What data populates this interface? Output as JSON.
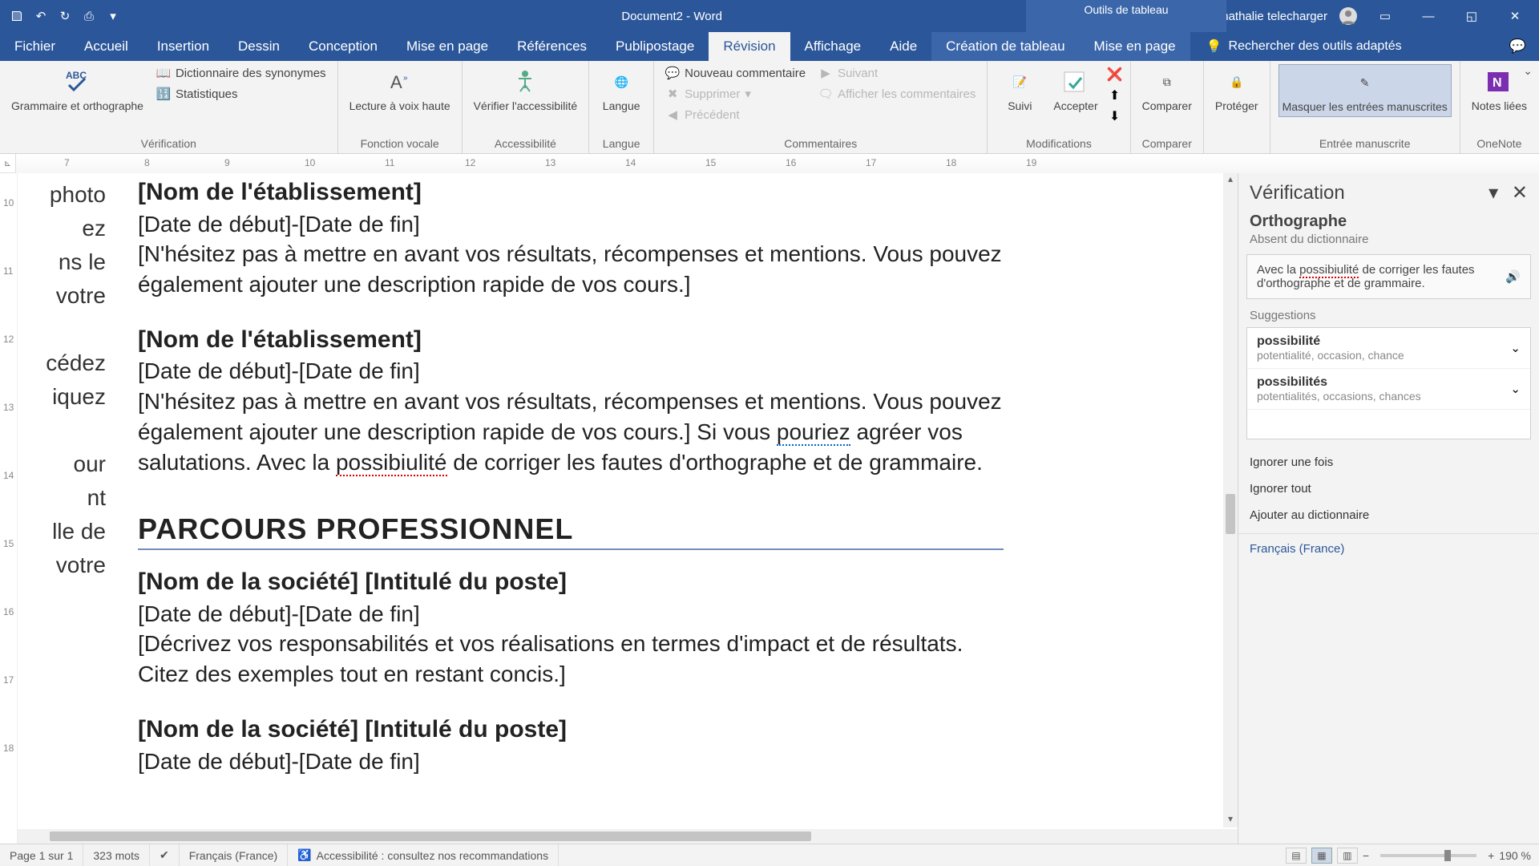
{
  "title": "Document2 - Word",
  "tableTools": "Outils de tableau",
  "userName": "nathalie telecharger",
  "tabs": {
    "file": "Fichier",
    "home": "Accueil",
    "insert": "Insertion",
    "draw": "Dessin",
    "design": "Conception",
    "layout": "Mise en page",
    "references": "Références",
    "mailings": "Publipostage",
    "review": "Révision",
    "view": "Affichage",
    "help": "Aide",
    "tableDesign": "Création de tableau",
    "tableLayout": "Mise en page",
    "tellMe": "Rechercher des outils adaptés"
  },
  "ribbon": {
    "proofing": {
      "spelling": "Grammaire et orthographe",
      "thesaurus": "Dictionnaire des synonymes",
      "stats": "Statistiques",
      "label": "Vérification"
    },
    "speech": {
      "readAloud": "Lecture à voix haute",
      "label": "Fonction vocale"
    },
    "a11y": {
      "check": "Vérifier l'accessibilité",
      "label": "Accessibilité"
    },
    "language": {
      "btn": "Langue",
      "label": "Langue"
    },
    "comments": {
      "new": "Nouveau commentaire",
      "delete": "Supprimer",
      "prev": "Précédent",
      "next": "Suivant",
      "show": "Afficher les commentaires",
      "label": "Commentaires"
    },
    "tracking": {
      "track": "Suivi",
      "label": "Modifications"
    },
    "accept": "Accepter",
    "compare": {
      "btn": "Comparer",
      "label": "Comparer"
    },
    "protect": "Protéger",
    "ink": {
      "hide": "Masquer les entrées manuscrites",
      "label": "Entrée manuscrite"
    },
    "onenote": {
      "linked": "Notes liées",
      "label": "OneNote"
    }
  },
  "hruler": [
    "7",
    "8",
    "9",
    "10",
    "11",
    "12",
    "13",
    "14",
    "15",
    "16",
    "17",
    "18",
    "19"
  ],
  "vruler": [
    "10",
    "11",
    "12",
    "13",
    "14",
    "15",
    "16",
    "17",
    "18"
  ],
  "leftStrip": [
    "photo",
    "ez",
    "ns le",
    "votre",
    "",
    "cédez",
    "iquez",
    "",
    "our",
    "nt",
    "lle de",
    "votre"
  ],
  "doc": {
    "s1": {
      "title": "[Nom de l'établissement]",
      "dates": "[Date de début]-[Date de fin]",
      "body": "[N'hésitez pas à mettre en avant vos résultats, récompenses et mentions. Vous pouvez également ajouter une description rapide de vos cours.]"
    },
    "s2": {
      "title": "[Nom de l'établissement]",
      "dates": "[Date de début]-[Date de fin]",
      "body_a": "[N'hésitez pas à mettre en avant vos résultats, récompenses et mentions. Vous pouvez également ajouter une description rapide de vos cours.] Si vous ",
      "err1": "pouriez",
      "body_b": " agréer vos salutations. Avec la ",
      "err2": "possibiulité",
      "body_c": " de corriger les fautes d'orthographe et de grammaire."
    },
    "h2": "PARCOURS PROFESSIONNEL",
    "s3": {
      "title": "[Nom de la société] [Intitulé du poste]",
      "dates": "[Date de début]-[Date de fin]",
      "body": "[Décrivez vos responsabilités et vos réalisations en termes d'impact et de résultats. Citez des exemples tout en restant concis.]"
    },
    "s4": {
      "title": "[Nom de la société] [Intitulé du poste]",
      "dates": "[Date de début]-[Date de fin]"
    }
  },
  "pane": {
    "title": "Vérification",
    "cat": "Orthographe",
    "sub": "Absent du dictionnaire",
    "context_a": "Avec la ",
    "context_err": "possibiulité",
    "context_b": " de corriger les fautes d'orthographe et de grammaire.",
    "sugLabel": "Suggestions",
    "sug": [
      {
        "w": "possibilité",
        "d": "potentialité, occasion, chance"
      },
      {
        "w": "possibilités",
        "d": "potentialités, occasions, chances"
      }
    ],
    "ignoreOnce": "Ignorer une fois",
    "ignoreAll": "Ignorer tout",
    "addDict": "Ajouter au dictionnaire",
    "lang": "Français (France)"
  },
  "status": {
    "page": "Page 1 sur 1",
    "words": "323 mots",
    "lang": "Français (France)",
    "a11y": "Accessibilité : consultez nos recommandations",
    "zoom": "190 %"
  },
  "colors": {
    "accent": "#2b579a"
  }
}
